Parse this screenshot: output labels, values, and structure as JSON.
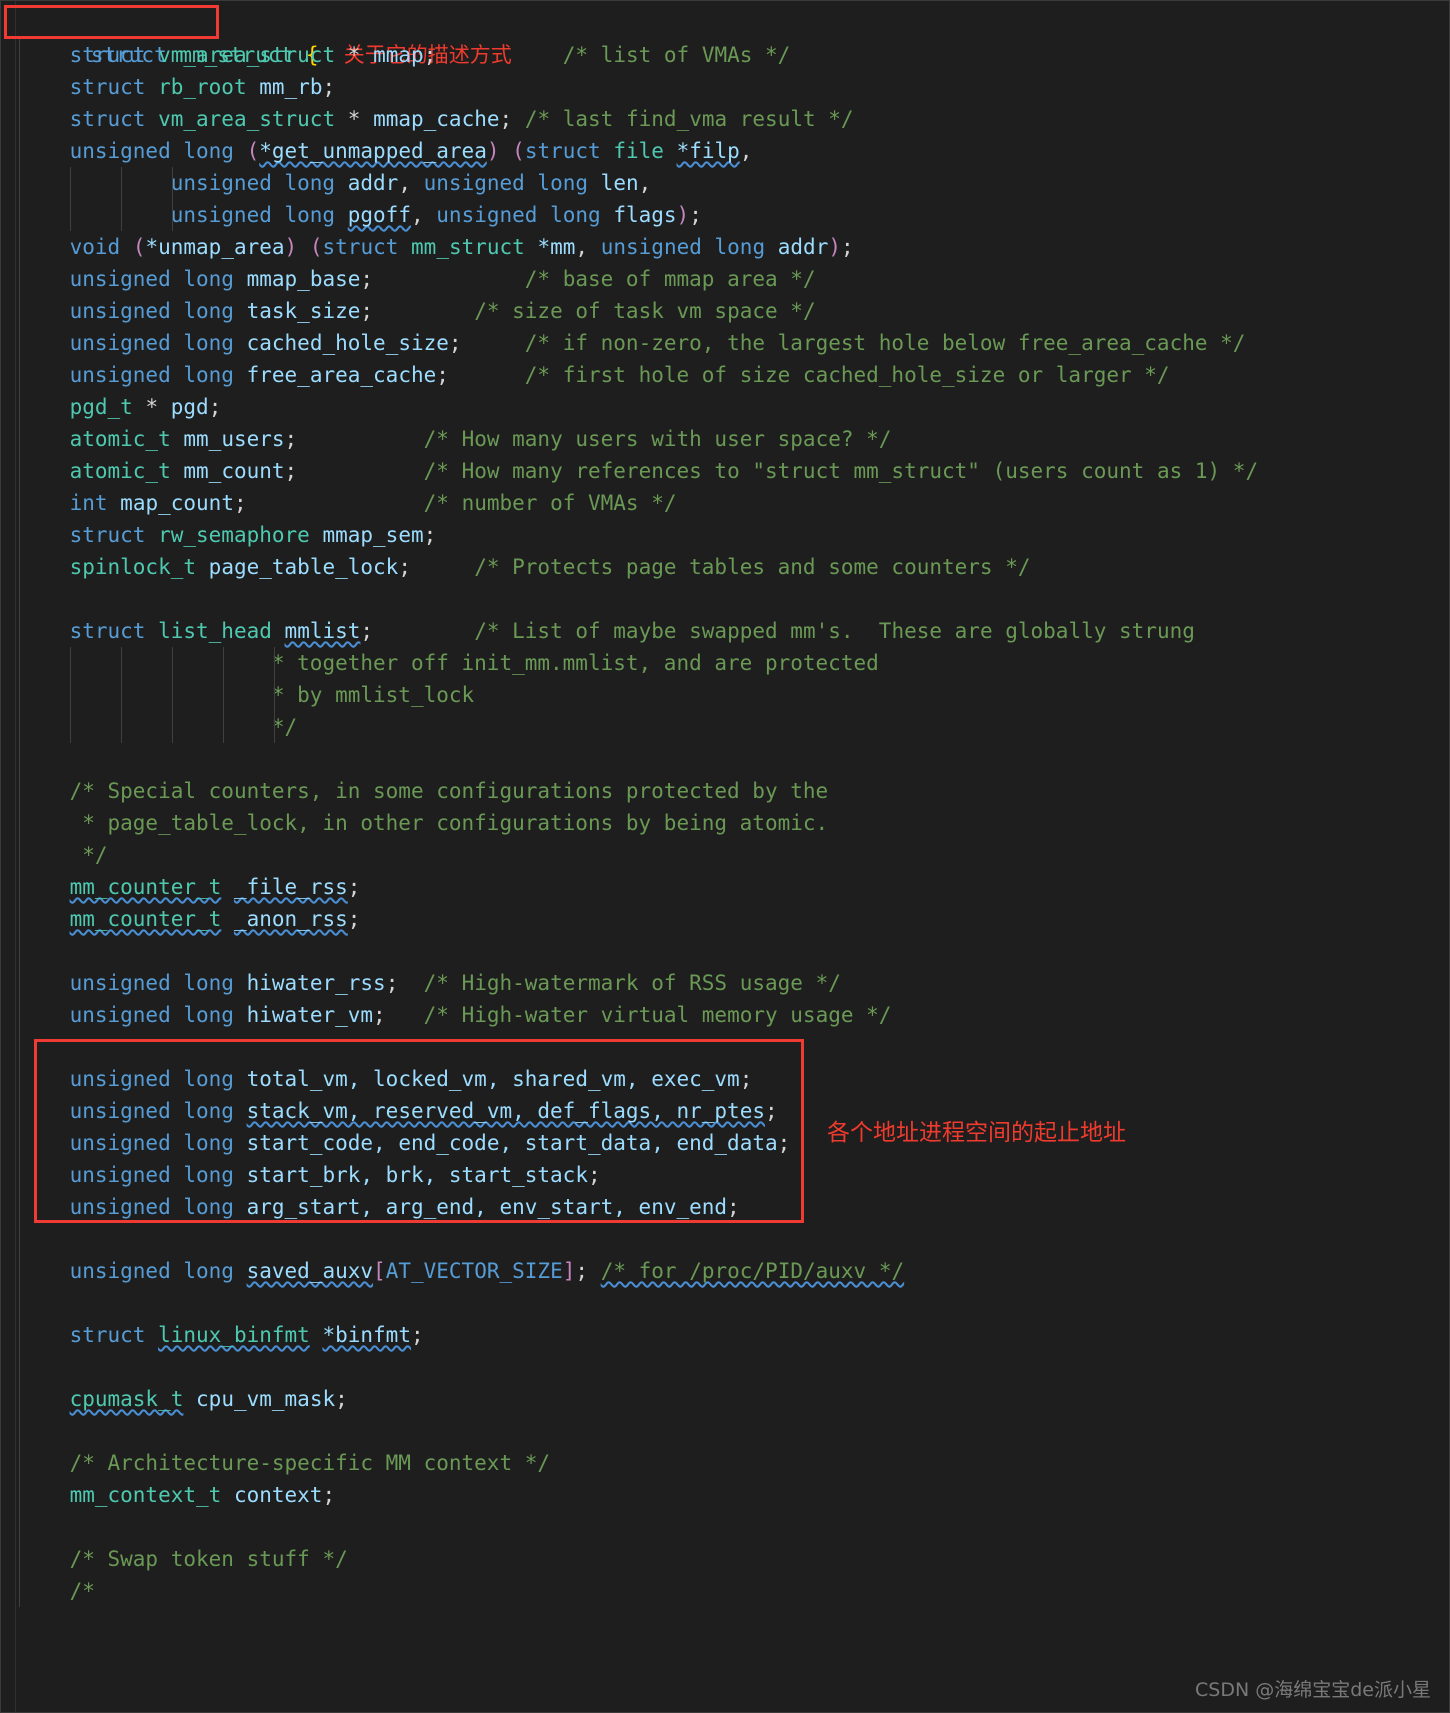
{
  "editor": {
    "background": "#1e1e1e",
    "theme": "dark-plus",
    "language": "c"
  },
  "colors": {
    "keyword": "#569cd6",
    "type": "#4ec9b0",
    "variable": "#9cdcfe",
    "comment": "#6a9955",
    "punctuation": "#d4d4d4",
    "brace": "#ffd700",
    "magenta": "#c586c0",
    "annotation_red": "#ef3b2e",
    "squiggle_blue": "#4a8fd4"
  },
  "annotations": {
    "title_note": "关于它的描述方式",
    "address_note": "各个地址进程空间的起止地址",
    "watermark": "CSDN @海绵宝宝de派小星"
  },
  "code": {
    "title": "struct mm_struct {",
    "lines": [
      "struct mm_struct { 关于它的描述方式",
      "    struct vm_area_struct * mmap;          /* list of VMAs */",
      "    struct rb_root mm_rb;",
      "    struct vm_area_struct * mmap_cache; /* last find_vma result */",
      "    unsigned long (*get_unmapped_area) (struct file *filp,",
      "                unsigned long addr, unsigned long len,",
      "                unsigned long pgoff, unsigned long flags);",
      "    void (*unmap_area) (struct mm_struct *mm, unsigned long addr);",
      "    unsigned long mmap_base;            /* base of mmap area */",
      "    unsigned long task_size;        /* size of task vm space */",
      "    unsigned long cached_hole_size;     /* if non-zero, the largest hole below free_area_cache */",
      "    unsigned long free_area_cache;      /* first hole of size cached_hole_size or larger */",
      "    pgd_t * pgd;",
      "    atomic_t mm_users;          /* How many users with user space? */",
      "    atomic_t mm_count;          /* How many references to \"struct mm_struct\" (users count as 1) */",
      "    int map_count;              /* number of VMAs */",
      "    struct rw_semaphore mmap_sem;",
      "    spinlock_t page_table_lock;     /* Protects page tables and some counters */",
      "",
      "    struct list_head mmlist;        /* List of maybe swapped mm's.  These are globally strung",
      "                    * together off init_mm.mmlist, and are protected",
      "                    * by mmlist_lock",
      "                    */",
      "",
      "    /* Special counters, in some configurations protected by the",
      "     * page_table_lock, in other configurations by being atomic.",
      "     */",
      "    mm_counter_t _file_rss;",
      "    mm_counter_t _anon_rss;",
      "",
      "    unsigned long hiwater_rss;  /* High-watermark of RSS usage */",
      "    unsigned long hiwater_vm;   /* High-water virtual memory usage */",
      "",
      "    unsigned long total_vm, locked_vm, shared_vm, exec_vm;",
      "    unsigned long stack_vm, reserved_vm, def_flags, nr_ptes;",
      "    unsigned long start_code, end_code, start_data, end_data;",
      "    unsigned long start_brk, brk, start_stack;",
      "    unsigned long arg_start, arg_end, env_start, env_end;",
      "",
      "    unsigned long saved_auxv[AT_VECTOR_SIZE]; /* for /proc/PID/auxv */",
      "",
      "    struct linux_binfmt *binfmt;",
      "",
      "    cpumask_t cpu_vm_mask;",
      "",
      "    /* Architecture-specific MM context */",
      "    mm_context_t context;",
      "",
      "    /* Swap token stuff */",
      "    /*"
    ]
  },
  "tokens": {
    "l0": {
      "a": "struct",
      "b": "mm_struct",
      "c": "{",
      "d": "关于它的描述方式"
    },
    "l1": {
      "kw": "struct",
      "typ": "vm_area_struct",
      "star": "*",
      "var": "mmap",
      "cmt": "/* list of VMAs */"
    },
    "l2": {
      "kw": "struct",
      "typ": "rb_root",
      "var": "mm_rb"
    },
    "l3": {
      "kw": "struct",
      "typ": "vm_area_struct",
      "star": "*",
      "var": "mmap_cache",
      "cmt": "/* last find_vma result */"
    },
    "l4": {
      "kw": "unsigned long",
      "fn": "*get_unmapped_area",
      "kw2": "struct",
      "typ": "file",
      "var": "*filp"
    },
    "l5": {
      "kw": "unsigned long",
      "var": "addr",
      "kw2": "unsigned long",
      "var2": "len"
    },
    "l6": {
      "kw": "unsigned long",
      "var": "pgoff",
      "kw2": "unsigned long",
      "var2": "flags"
    },
    "l7": {
      "kw": "void",
      "fn": "*unmap_area",
      "kw2": "struct",
      "typ": "mm_struct",
      "var": "*mm",
      "kw3": "unsigned long",
      "var2": "addr"
    },
    "l8": {
      "kw": "unsigned long",
      "var": "mmap_base",
      "cmt": "/* base of mmap area */"
    },
    "l9": {
      "kw": "unsigned long",
      "var": "task_size",
      "cmt": "/* size of task vm space */"
    },
    "l10": {
      "kw": "unsigned long",
      "var": "cached_hole_size",
      "cmt": "/* if non-zero, the largest hole below free_area_cache */"
    },
    "l11": {
      "kw": "unsigned long",
      "var": "free_area_cache",
      "cmt": "/* first hole of size cached_hole_size or larger */"
    },
    "l12": {
      "typ": "pgd_t",
      "star": "*",
      "var": "pgd"
    },
    "l13": {
      "typ": "atomic_t",
      "var": "mm_users",
      "cmt": "/* How many users with user space? */"
    },
    "l14": {
      "typ": "atomic_t",
      "var": "mm_count",
      "cmt": "/* How many references to \"struct mm_struct\" (users count as 1) */"
    },
    "l15": {
      "kw": "int",
      "var": "map_count",
      "cmt": "/* number of VMAs */"
    },
    "l16": {
      "kw": "struct",
      "typ": "rw_semaphore",
      "var": "mmap_sem"
    },
    "l17": {
      "typ": "spinlock_t",
      "var": "page_table_lock",
      "cmt": "/* Protects page tables and some counters */"
    },
    "l19": {
      "kw": "struct",
      "typ": "list_head",
      "var": "mmlist",
      "cmt": "/* List of maybe swapped mm's.  These are globally strung"
    },
    "l20": {
      "cmt": "* together off init_mm.mmlist, and are protected"
    },
    "l21": {
      "cmt": "* by mmlist_lock"
    },
    "l22": {
      "cmt": "*/"
    },
    "l24": {
      "cmt": "/* Special counters, in some configurations protected by the"
    },
    "l25": {
      "cmt": "* page_table_lock, in other configurations by being atomic."
    },
    "l26": {
      "cmt": "*/"
    },
    "l27": {
      "typ": "mm_counter_t",
      "var": "_file_rss"
    },
    "l28": {
      "typ": "mm_counter_t",
      "var": "_anon_rss"
    },
    "l30": {
      "kw": "unsigned long",
      "var": "hiwater_rss",
      "cmt": "/* High-watermark of RSS usage */"
    },
    "l31": {
      "kw": "unsigned long",
      "var": "hiwater_vm",
      "cmt": "/* High-water virtual memory usage */"
    },
    "l33": {
      "kw": "unsigned long",
      "vars": "total_vm, locked_vm, shared_vm, exec_vm"
    },
    "l34": {
      "kw": "unsigned long",
      "vars": "stack_vm, reserved_vm, def_flags, nr_ptes"
    },
    "l35": {
      "kw": "unsigned long",
      "vars": "start_code, end_code, start_data, end_data"
    },
    "l36": {
      "kw": "unsigned long",
      "vars": "start_brk, brk, start_stack"
    },
    "l37": {
      "kw": "unsigned long",
      "vars": "arg_start, arg_end, env_start, env_end"
    },
    "l39": {
      "kw": "unsigned long",
      "var": "saved_auxv",
      "mac": "AT_VECTOR_SIZE",
      "cmt": "/* for /proc/PID/auxv */"
    },
    "l41": {
      "kw": "struct",
      "typ": "linux_binfmt",
      "var": "*binfmt"
    },
    "l43": {
      "typ": "cpumask_t",
      "var": "cpu_vm_mask"
    },
    "l45": {
      "cmt": "/* Architecture-specific MM context */"
    },
    "l46": {
      "typ": "mm_context_t",
      "var": "context"
    },
    "l48": {
      "cmt": "/* Swap token stuff */"
    },
    "l49": {
      "cmt": "/*"
    }
  }
}
